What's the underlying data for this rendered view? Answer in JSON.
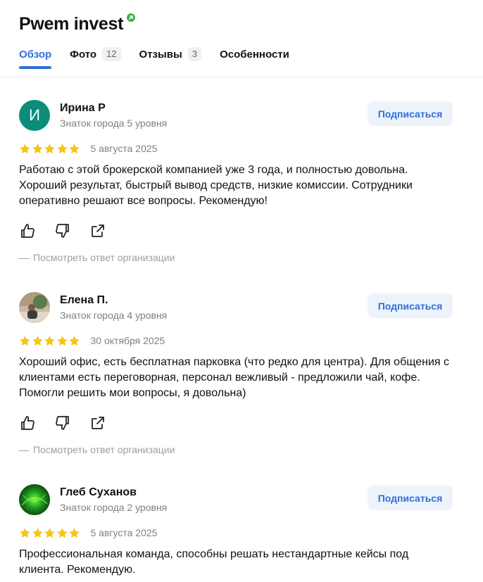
{
  "header": {
    "title": "Pwem invest",
    "verified_icon": "verified-arrow-icon",
    "verified_color": "#3bb54a"
  },
  "tabs": [
    {
      "label": "Обзор",
      "active": true
    },
    {
      "label": "Фото",
      "count": "12"
    },
    {
      "label": "Отзывы",
      "count": "3"
    },
    {
      "label": "Особенности"
    }
  ],
  "colors": {
    "accent": "#2f6fd6",
    "star": "#f5c518",
    "muted": "#808080"
  },
  "reviews": [
    {
      "author": "Ирина Р",
      "avatar_letter": "И",
      "level": "Знаток города 5 уровня",
      "subscribe": "Подписаться",
      "stars": 5,
      "date": "5 августа 2025",
      "text": "Работаю с этой брокерской компанией уже 3 года, и полностью довольна. Хороший результат, быстрый вывод средств, низкие комиссии. Сотрудники оперативно решают все вопросы. Рекомендую!",
      "org_reply": "Посмотреть ответ организации"
    },
    {
      "author": "Елена П.",
      "level": "Знаток города 4 уровня",
      "subscribe": "Подписаться",
      "stars": 5,
      "date": "30 октября 2025",
      "text": "Хороший офис, есть бесплатная парковка (что редко для центра). Для общения с клиентами есть переговорная, персонал вежливый - предложили чай, кофе. Помогли решить мои вопросы, я довольна)",
      "org_reply": "Посмотреть ответ организации"
    },
    {
      "author": "Глеб Суханов",
      "level": "Знаток города 2 уровня",
      "subscribe": "Подписаться",
      "stars": 5,
      "date": "5 августа 2025",
      "text": "Профессиональная команда, способны решать нестандартные кейсы под клиента. Рекомендую."
    }
  ],
  "icons": {
    "like": "thumb-up-icon",
    "dislike": "thumb-down-icon",
    "share": "share-icon",
    "star": "star-icon"
  }
}
